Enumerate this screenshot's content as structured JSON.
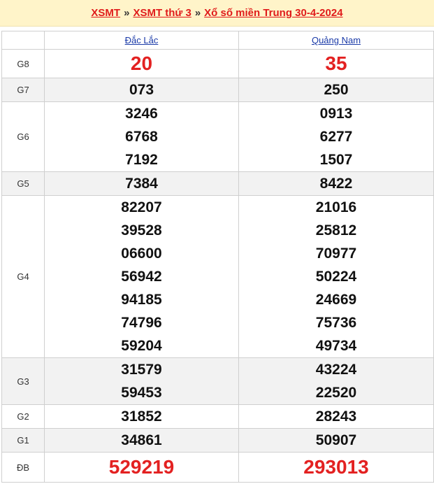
{
  "breadcrumb": {
    "item1": "XSMT",
    "sep1": "»",
    "item2": "XSMT thứ 3",
    "sep2": "»",
    "item3": "Xổ số miền Trung 30-4-2024"
  },
  "provinces": [
    "Đắc Lắc",
    "Quảng Nam"
  ],
  "prizes": [
    {
      "label": "G8",
      "a": [
        "20"
      ],
      "b": [
        "35"
      ]
    },
    {
      "label": "G7",
      "a": [
        "073"
      ],
      "b": [
        "250"
      ]
    },
    {
      "label": "G6",
      "a": [
        "3246",
        "6768",
        "7192"
      ],
      "b": [
        "0913",
        "6277",
        "1507"
      ]
    },
    {
      "label": "G5",
      "a": [
        "7384"
      ],
      "b": [
        "8422"
      ]
    },
    {
      "label": "G4",
      "a": [
        "82207",
        "39528",
        "06600",
        "56942",
        "94185",
        "74796",
        "59204"
      ],
      "b": [
        "21016",
        "25812",
        "70977",
        "50224",
        "24669",
        "75736",
        "49734"
      ]
    },
    {
      "label": "G3",
      "a": [
        "31579",
        "59453"
      ],
      "b": [
        "43224",
        "22520"
      ]
    },
    {
      "label": "G2",
      "a": [
        "31852"
      ],
      "b": [
        "28243"
      ]
    },
    {
      "label": "G1",
      "a": [
        "34861"
      ],
      "b": [
        "50907"
      ]
    },
    {
      "label": "ĐB",
      "a": [
        "529219"
      ],
      "b": [
        "293013"
      ]
    }
  ],
  "colors": {
    "accent_red": "#e32121",
    "link_blue": "#1a3aa8",
    "header_bg": "#fff4c9"
  }
}
